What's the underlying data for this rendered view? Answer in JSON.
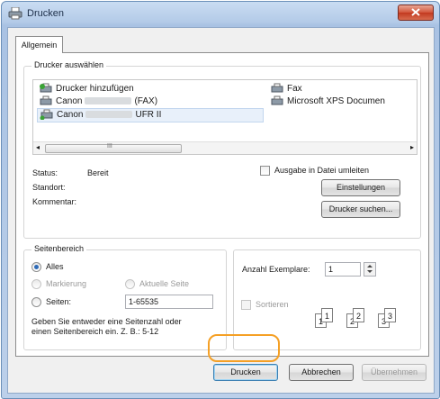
{
  "window": {
    "title": "Drucken",
    "title_icon": "printer-icon",
    "close_icon": "close-icon"
  },
  "tabs": [
    {
      "label": "Allgemein"
    }
  ],
  "printer_group": {
    "label": "Drucker auswählen",
    "printers": [
      {
        "name": "Drucker hinzufügen",
        "icon": "add-printer-icon"
      },
      {
        "name_prefix": "Canon",
        "name_suffix": "(FAX)",
        "icon": "printer-icon"
      },
      {
        "name_prefix": "Canon",
        "name_suffix": "UFR II",
        "icon": "printer-icon",
        "selected": true
      },
      {
        "name": "Fax",
        "icon": "fax-icon"
      },
      {
        "name": "Microsoft XPS Documen",
        "icon": "printer-icon"
      }
    ],
    "scroll_mid": "III",
    "status_label": "Status:",
    "status_value": "Bereit",
    "location_label": "Standort:",
    "comment_label": "Kommentar:",
    "print_to_file_label": "Ausgabe in Datei umleiten",
    "settings_button": "Einstellungen",
    "find_printer_button": "Drucker suchen..."
  },
  "page_range": {
    "label": "Seitenbereich",
    "all_label": "Alles",
    "selection_label": "Markierung",
    "current_page_label": "Aktuelle Seite",
    "pages_label": "Seiten:",
    "pages_value": "1-65535",
    "hint_line1": "Geben Sie entweder eine Seitenzahl oder",
    "hint_line2": "einen Seitenbereich ein. Z. B.: 5-12"
  },
  "copies": {
    "label": "Anzahl Exemplare:",
    "value": "1",
    "collate_label": "Sortieren",
    "pages": [
      "1",
      "1",
      "2",
      "2",
      "3",
      "3"
    ]
  },
  "footer": {
    "print_button": "Drucken",
    "cancel_button": "Abbrechen",
    "apply_button": "Übernehmen"
  },
  "colors": {
    "highlight": "#f5a025",
    "accent": "#2e6bb7"
  }
}
